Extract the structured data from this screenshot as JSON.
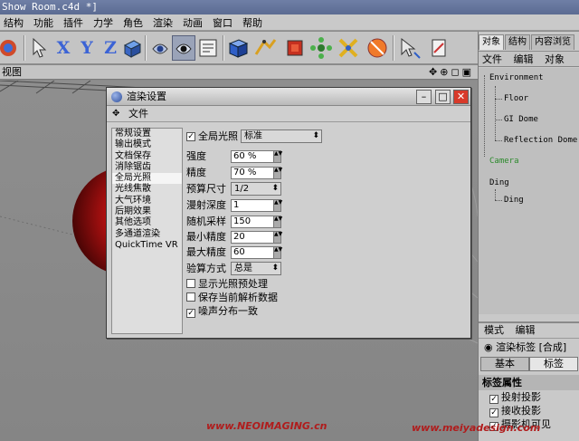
{
  "window": {
    "title": "Show Room.c4d *]"
  },
  "menubar": [
    "结构",
    "功能",
    "插件",
    "力学",
    "角色",
    "渲染",
    "动画",
    "窗口",
    "帮助"
  ],
  "toolbar": {
    "axis_x": "X",
    "axis_y": "Y",
    "axis_z": "Z"
  },
  "viewport": {
    "label": "视图"
  },
  "right_panel": {
    "tabs": [
      "对象",
      "结构",
      "内容浏览"
    ],
    "menu": [
      "文件",
      "编辑",
      "对象"
    ],
    "tree": {
      "environment": "Environment",
      "floor": "Floor",
      "gi_dome": "GI Dome",
      "reflection_dome": "Reflection Dome",
      "camera": "Camera",
      "ding_parent": "Ding",
      "ding_child": "Ding"
    },
    "attributes": {
      "menu": [
        "模式",
        "编辑"
      ],
      "title": "渲染标签 [合成]",
      "tabs": [
        "基本",
        "标签"
      ],
      "section": "标签属性",
      "rows": [
        {
          "label": "投射投影",
          "checked": true
        },
        {
          "label": "接收投影",
          "checked": true
        },
        {
          "label": "摄影机可见",
          "checked": true
        }
      ]
    }
  },
  "dialog": {
    "title": "渲染设置",
    "menu_file": "文件",
    "categories": [
      "常规设置",
      "输出模式",
      "文档保存",
      "消除锯齿",
      "全局光照",
      "光线焦散",
      "大气环境",
      "后期效果",
      "其他选项",
      "多通道渲染",
      "QuickTime VR"
    ],
    "selected_category": "全局光照",
    "gi": {
      "enable_label": "全局光照",
      "enabled": true,
      "mode": "标准",
      "strength_label": "强度",
      "strength": "60 %",
      "accuracy_label": "精度",
      "accuracy": "70 %",
      "prepass_label": "预算尺寸",
      "prepass": "1/2",
      "diffuse_depth_label": "漫射深度",
      "diffuse_depth": "1",
      "samples_label": "随机采样",
      "samples": "150",
      "min_res_label": "最小精度",
      "min_res": "20",
      "max_res_label": "最大精度",
      "max_res": "60",
      "method_label": "验算方式",
      "method": "总是",
      "show_prepass_label": "显示光照预处理",
      "show_prepass": false,
      "save_solution_label": "保存当前解析数据",
      "save_solution": false,
      "noise_label": "噪声分布一致",
      "noise": true
    }
  },
  "watermarks": {
    "left": "www.NEOIMAGING.cn",
    "right": "www.meiyadesign.com"
  },
  "colors": {
    "sphere": "#c81414",
    "camera_text": "#2b8a2b",
    "close_button": "#d83a2a",
    "axis_icons": "#3b63d6",
    "watermark": "#b01c1c"
  }
}
